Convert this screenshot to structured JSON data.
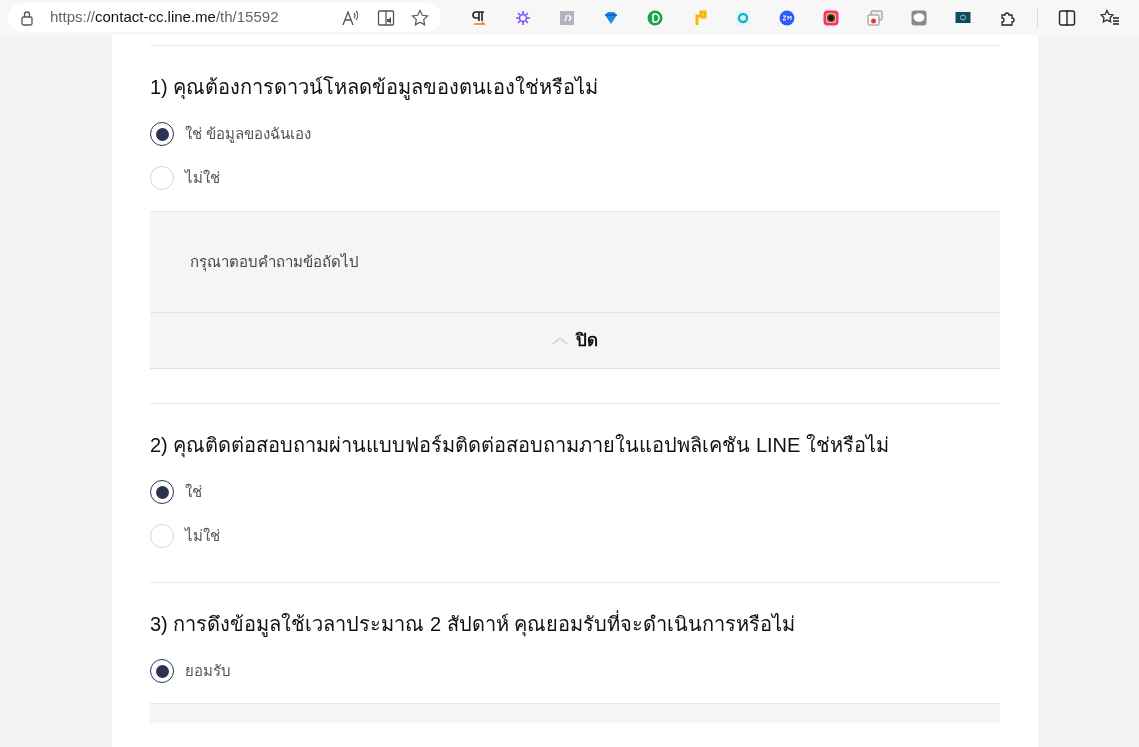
{
  "browser": {
    "url": {
      "scheme": "https://",
      "host": "contact-cc.line.me",
      "path": "/th/15592"
    }
  },
  "questions": [
    {
      "title": "1) คุณต้องการดาวน์โหลดข้อมูลของตนเองใช่หรือไม่",
      "options": [
        {
          "label": "ใช่ ข้อมูลของฉันเอง",
          "selected": true
        },
        {
          "label": "ไม่ใช่",
          "selected": false
        }
      ],
      "note": {
        "text": "กรุณาตอบคำถามข้อถัดไป",
        "close_label": "ปิด",
        "expanded": true
      }
    },
    {
      "title": "2) คุณติดต่อสอบถามผ่านแบบฟอร์มติดต่อสอบถามภายในแอปพลิเคชัน LINE ใช่หรือไม่",
      "options": [
        {
          "label": "ใช่",
          "selected": true
        },
        {
          "label": "ไม่ใช่",
          "selected": false
        }
      ]
    },
    {
      "title": "3) การดึงข้อมูลใช้เวลาประมาณ 2 สัปดาห์ คุณยอมรับที่จะดำเนินการหรือไม่",
      "options": [
        {
          "label": "ยอมรับ",
          "selected": true
        }
      ]
    }
  ]
}
